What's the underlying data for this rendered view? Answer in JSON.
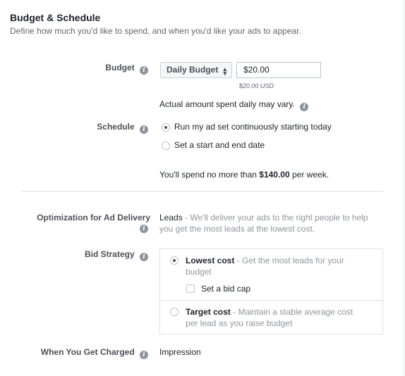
{
  "section": {
    "title": "Budget & Schedule",
    "subtitle": "Define how much you'd like to spend, and when you'd like your ads to appear."
  },
  "budget": {
    "label": "Budget",
    "type_selected": "Daily Budget",
    "amount": "$20.00",
    "amount_hint": "$20.00 USD",
    "note": "Actual amount spent daily may vary."
  },
  "schedule": {
    "label": "Schedule",
    "options": [
      {
        "label": "Run my ad set continuously starting today",
        "selected": true
      },
      {
        "label": "Set a start and end date",
        "selected": false
      }
    ],
    "spend_prefix": "You'll spend no more than ",
    "spend_amount": "$140.00",
    "spend_suffix": " per week."
  },
  "optimization": {
    "label": "Optimization for Ad Delivery",
    "value": "Leads",
    "desc_line1": " - We'll deliver your ads to the right people to help",
    "desc_line2": "you get the most leads at the lowest cost."
  },
  "bid_strategy": {
    "label": "Bid Strategy",
    "options": [
      {
        "title": "Lowest cost",
        "desc_line1": " - Get the most leads for your",
        "desc_line2": "budget",
        "selected": true
      },
      {
        "title": "Target cost",
        "desc_line1": " - Maintain a stable average cost",
        "desc_line2": "per lead as you raise budget",
        "selected": false
      }
    ],
    "bid_cap_label": "Set a bid cap"
  },
  "charged": {
    "label": "When You Get Charged",
    "value": "Impression"
  },
  "icons": {
    "info": "info-icon",
    "caret": "up-down-caret-icon"
  },
  "colors": {
    "text": "#1d2129",
    "muted": "#90949c",
    "label": "#4b4f56",
    "border": "#dddfe2"
  }
}
